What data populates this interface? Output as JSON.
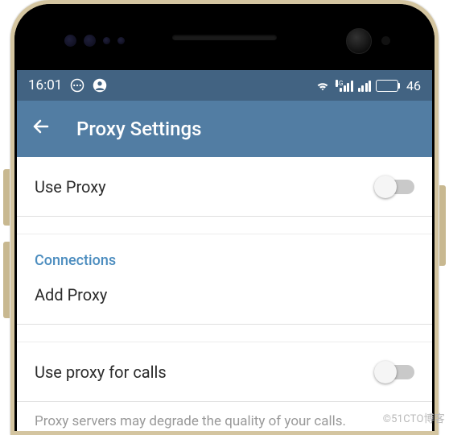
{
  "status": {
    "time": "16:01",
    "battery": "46",
    "signal_label": "4G"
  },
  "header": {
    "title": "Proxy Settings"
  },
  "rows": {
    "use_proxy": "Use Proxy",
    "connections_header": "Connections",
    "add_proxy": "Add Proxy",
    "use_proxy_calls": "Use proxy for calls",
    "hint": "Proxy servers may degrade the quality of your calls."
  },
  "watermark": "©51CTO博客"
}
